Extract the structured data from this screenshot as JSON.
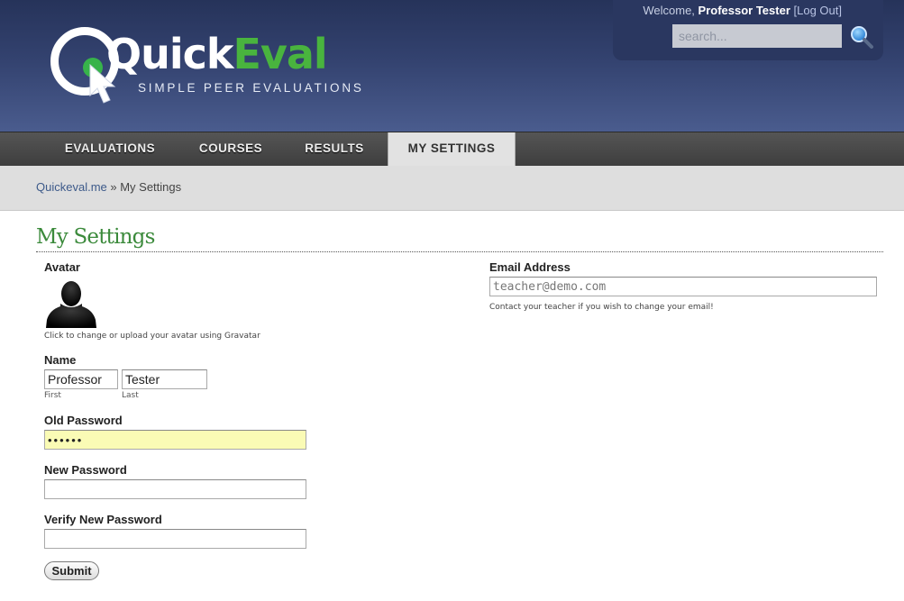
{
  "header": {
    "logo_word_quick": "Quick",
    "logo_word_eval": "Eval",
    "logo_tagline": "SIMPLE PEER EVALUATIONS",
    "welcome_prefix": "Welcome, ",
    "user_name": "Professor Tester",
    "logout_label": "[Log Out]",
    "search_placeholder": "search...",
    "search_icon": "magnifier-icon"
  },
  "nav": {
    "items": [
      {
        "label": "EVALUATIONS",
        "active": false
      },
      {
        "label": "COURSES",
        "active": false
      },
      {
        "label": "RESULTS",
        "active": false
      },
      {
        "label": "MY SETTINGS",
        "active": true
      }
    ]
  },
  "breadcrumb": {
    "home": "Quickeval.me",
    "separator": " » ",
    "current": "My Settings"
  },
  "page": {
    "title": "My Settings"
  },
  "form": {
    "avatar_label": "Avatar",
    "avatar_hint": "Click to change or upload your avatar using Gravatar",
    "name_label": "Name",
    "first_name_value": "Professor",
    "last_name_value": "Tester",
    "first_sub": "First",
    "last_sub": "Last",
    "old_password_label": "Old Password",
    "old_password_value": "••••••",
    "new_password_label": "New Password",
    "new_password_value": "",
    "verify_password_label": "Verify New Password",
    "verify_password_value": "",
    "submit_label": "Submit",
    "email_label": "Email Address",
    "email_value": "teacher@demo.com",
    "email_hint": "Contact your teacher if you wish to change your email!"
  },
  "colors": {
    "header_top": "#26335a",
    "header_bottom": "#4a5c8e",
    "brand_green": "#49b43e",
    "title_green": "#3b8a3b",
    "nav_bg": "#444444",
    "nav_active_bg": "#e2e2e2",
    "password_highlight": "#fafbb5",
    "link_blue": "#3d5a8a"
  }
}
